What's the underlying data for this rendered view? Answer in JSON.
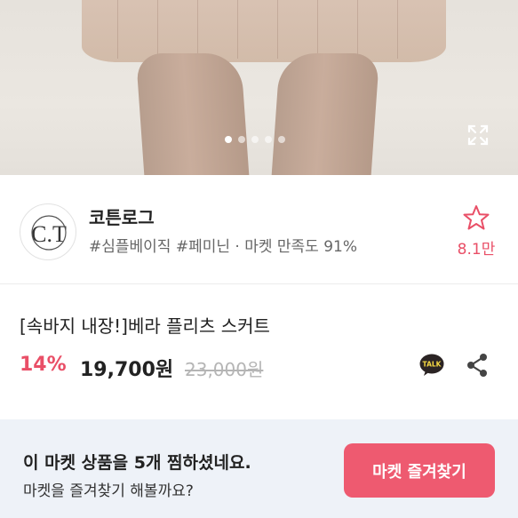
{
  "hero": {
    "slide_count": 5,
    "active_slide": 1,
    "expand_icon": "expand-icon"
  },
  "seller": {
    "name": "코튼로그",
    "logo_text": "C.T",
    "tags": "#심플베이직 #페미닌 · 마켓 만족도 91%",
    "favorite_icon": "star-outline-icon",
    "favorite_count": "8.1만"
  },
  "product": {
    "title": "[속바지 내장!]베라 플리츠 스커트",
    "discount": "14%",
    "price": "19,700원",
    "original_price": "23,000원",
    "talk_icon_label": "TALK",
    "share_icon": "share-icon"
  },
  "banner": {
    "title": "이 마켓 상품을 5개 찜하셨네요.",
    "subtitle": "마켓을 즐겨찾기 해볼까요?",
    "button_label": "마켓 즐겨찾기"
  },
  "colors": {
    "accent": "#ee5a70",
    "discount": "#e94f67",
    "banner_bg": "#eef2f8"
  }
}
